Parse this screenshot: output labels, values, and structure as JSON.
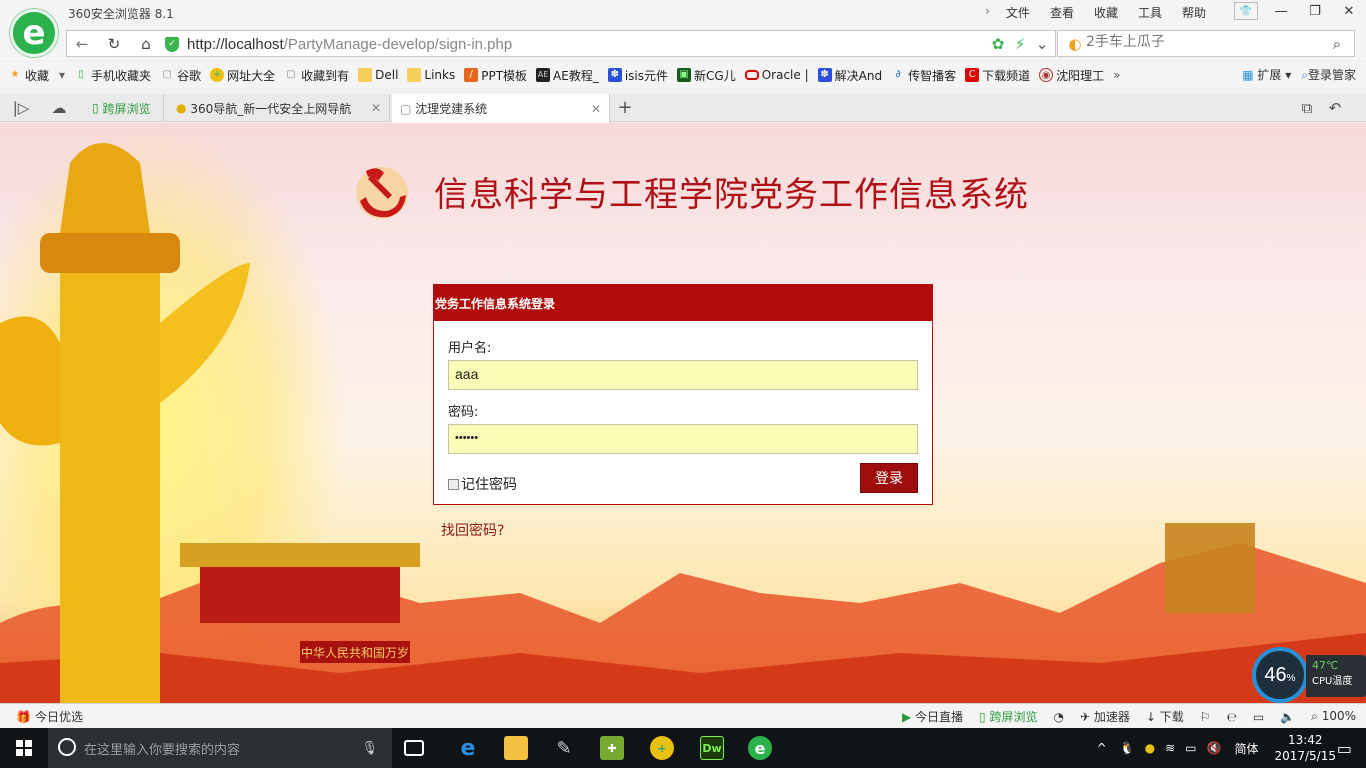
{
  "browser": {
    "app_title": "360安全浏览器 8.1",
    "menu": [
      "文件",
      "查看",
      "收藏",
      "工具",
      "帮助"
    ],
    "url_host": "http://localhost",
    "url_path": "/PartyManage-develop/sign-in.php",
    "search_placeholder": "2手车上瓜子",
    "colors": {
      "brand_green": "#2bb24c",
      "chrome": "#f4f4f4"
    }
  },
  "bookmarks": {
    "items": [
      {
        "label": "收藏",
        "icon": "star-icon"
      },
      {
        "label": "手机收藏夹",
        "icon": "phone-icon"
      },
      {
        "label": "谷歌",
        "icon": "page-icon"
      },
      {
        "label": "网址大全",
        "icon": "360-icon"
      },
      {
        "label": "收藏到有",
        "icon": "page-icon"
      },
      {
        "label": "Dell",
        "icon": "folder-icon"
      },
      {
        "label": "Links",
        "icon": "folder-icon"
      },
      {
        "label": "PPT模板",
        "icon": "ppt-icon"
      },
      {
        "label": "AE教程_",
        "icon": "ae-icon"
      },
      {
        "label": "isis元件",
        "icon": "paw-icon"
      },
      {
        "label": "新CG儿",
        "icon": "cg-icon"
      },
      {
        "label": "Oracle |",
        "icon": "oracle-icon"
      },
      {
        "label": "解决And",
        "icon": "paw-icon"
      },
      {
        "label": "传智播客",
        "icon": "chuanzhi-icon"
      },
      {
        "label": "下载频道",
        "icon": "c-icon"
      },
      {
        "label": "沈阳理工",
        "icon": "school-icon"
      }
    ],
    "extensions_label": "扩展",
    "login_manager_label": "登录管家"
  },
  "tabs": [
    {
      "label": "跨屏浏览"
    },
    {
      "label": "360导航_新一代安全上网导航"
    },
    {
      "label": "沈理党建系统"
    }
  ],
  "page": {
    "title": "信息科学与工程学院党务工作信息系统",
    "login_header": "党务工作信息系统登录",
    "username_label": "用户名:",
    "username_value": "aaa",
    "password_label": "密码:",
    "password_value": "••••••",
    "remember_label": "记住密码",
    "login_button": "登录",
    "forgot_link": "找回密码?",
    "tiananmen_banner": "中华人民共和国万岁",
    "colors": {
      "party_red": "#b10d0d",
      "input_bg": "#fafcb8"
    }
  },
  "cpu_widget": {
    "usage_percent": "46",
    "percent_sign": "%",
    "temperature": "47℃",
    "label": "CPU温度",
    "side_ball": "46"
  },
  "statusbar": {
    "left": "今日优选",
    "right": [
      "今日直播",
      "跨屏浏览",
      "加速器",
      "下载"
    ],
    "zoom": "100%"
  },
  "taskbar": {
    "search_placeholder": "在这里输入你要搜索的内容",
    "ime": "简体",
    "time": "13:42",
    "date": "2017/5/15"
  }
}
